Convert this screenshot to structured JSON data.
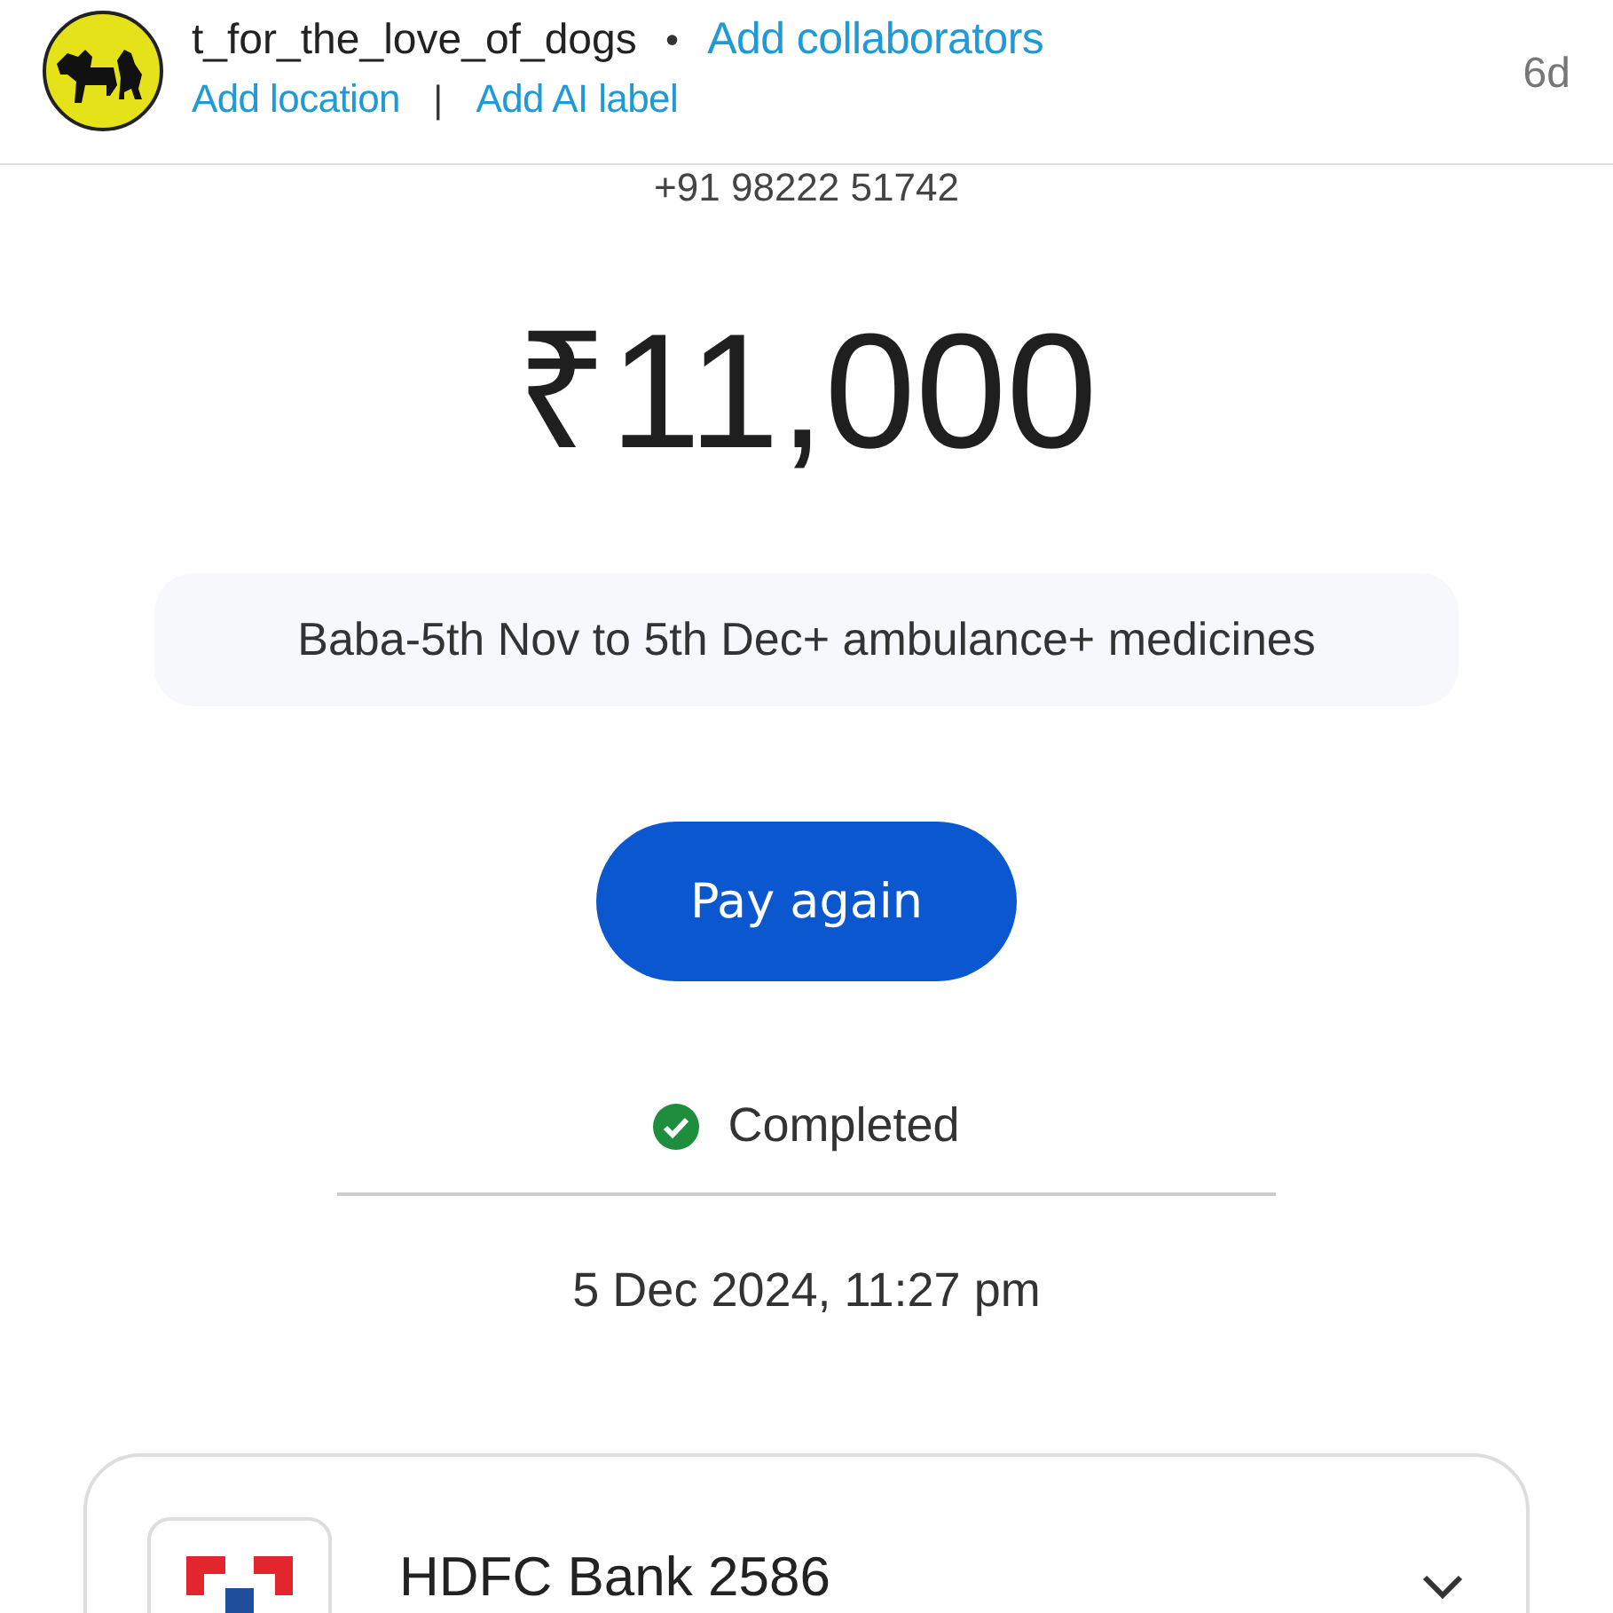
{
  "post_header": {
    "username": "t_for_the_love_of_dogs",
    "separator": "•",
    "collaborators_link": "Add collaborators",
    "location_link": "Add location",
    "divider": "|",
    "ai_label_link": "Add AI label",
    "age": "6d"
  },
  "payment": {
    "phone": "+91 98222 51742",
    "amount": "₹11,000",
    "note": "Baba-5th Nov to 5th Dec+ ambulance+ medicines",
    "button": "Pay again",
    "status": {
      "label": "Completed",
      "completed": true
    },
    "datetime": "5 Dec 2024, 11:27 pm"
  },
  "account": {
    "bank": "HDFC Bank 2586",
    "expanded": false
  }
}
